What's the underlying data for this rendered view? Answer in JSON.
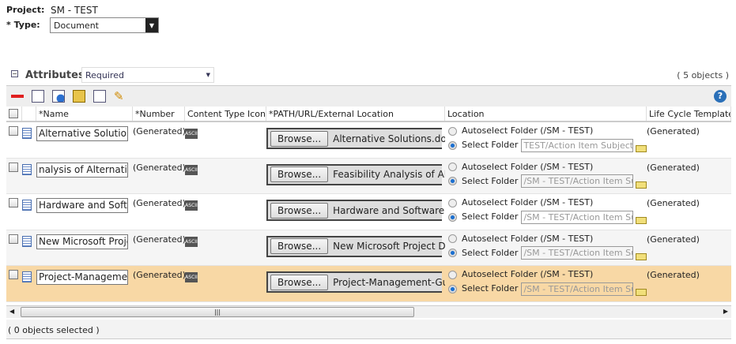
{
  "form": {
    "project_label": "Project:",
    "project_value": "SM - TEST",
    "type_label": "* Type:",
    "type_value": "Document"
  },
  "attributes": {
    "title": "Attributes",
    "filter": "Required",
    "count": "( 5 objects )"
  },
  "columns": [
    "*Name",
    "*Number",
    "Content Type Icon",
    "*PATH/URL/External Location",
    "Location",
    "Life Cycle Template"
  ],
  "rows": [
    {
      "name": "Alternative Solutions",
      "number": "(Generated)",
      "browse": "Browse...",
      "file": "Alternative Solutions.docx",
      "auto": "Autoselect Folder (/SM - TEST)",
      "select": "Select Folder",
      "folder": "TEST/Action Item Subjects",
      "lifecycle": "(Generated)",
      "highlight": false
    },
    {
      "name": "nalysis of Alternatives",
      "number": "(Generated)",
      "browse": "Browse...",
      "file": "Feasibility Analysis of Altern",
      "auto": "Autoselect Folder (/SM - TEST)",
      "select": "Select Folder",
      "folder": "/SM - TEST/Action Item Su",
      "lifecycle": "(Generated)",
      "highlight": false
    },
    {
      "name": "Hardware and Softwa",
      "number": "(Generated)",
      "browse": "Browse...",
      "file": "Hardware and Software Req",
      "auto": "Autoselect Folder (/SM - TEST)",
      "select": "Select Folder",
      "folder": "/SM - TEST/Action Item Su",
      "lifecycle": "(Generated)",
      "highlight": false
    },
    {
      "name": "New Microsoft Projec",
      "number": "(Generated)",
      "browse": "Browse...",
      "file": "New Microsoft Project Doc",
      "auto": "Autoselect Folder (/SM - TEST)",
      "select": "Select Folder",
      "folder": "/SM - TEST/Action Item Su",
      "lifecycle": "(Generated)",
      "highlight": false
    },
    {
      "name": "Project-Management",
      "number": "(Generated)",
      "browse": "Browse...",
      "file": "Project-Management-Guid",
      "auto": "Autoselect Folder (/SM - TEST)",
      "select": "Select Folder",
      "folder": "/SM - TEST/Action Item Su",
      "lifecycle": "(Generated)",
      "highlight": true
    }
  ],
  "icons": {
    "ascii": "ASCII"
  },
  "status": "( 0 objects selected )",
  "colors": {
    "highlight": "#f8d8a5",
    "alt": "#f5f5f5"
  }
}
